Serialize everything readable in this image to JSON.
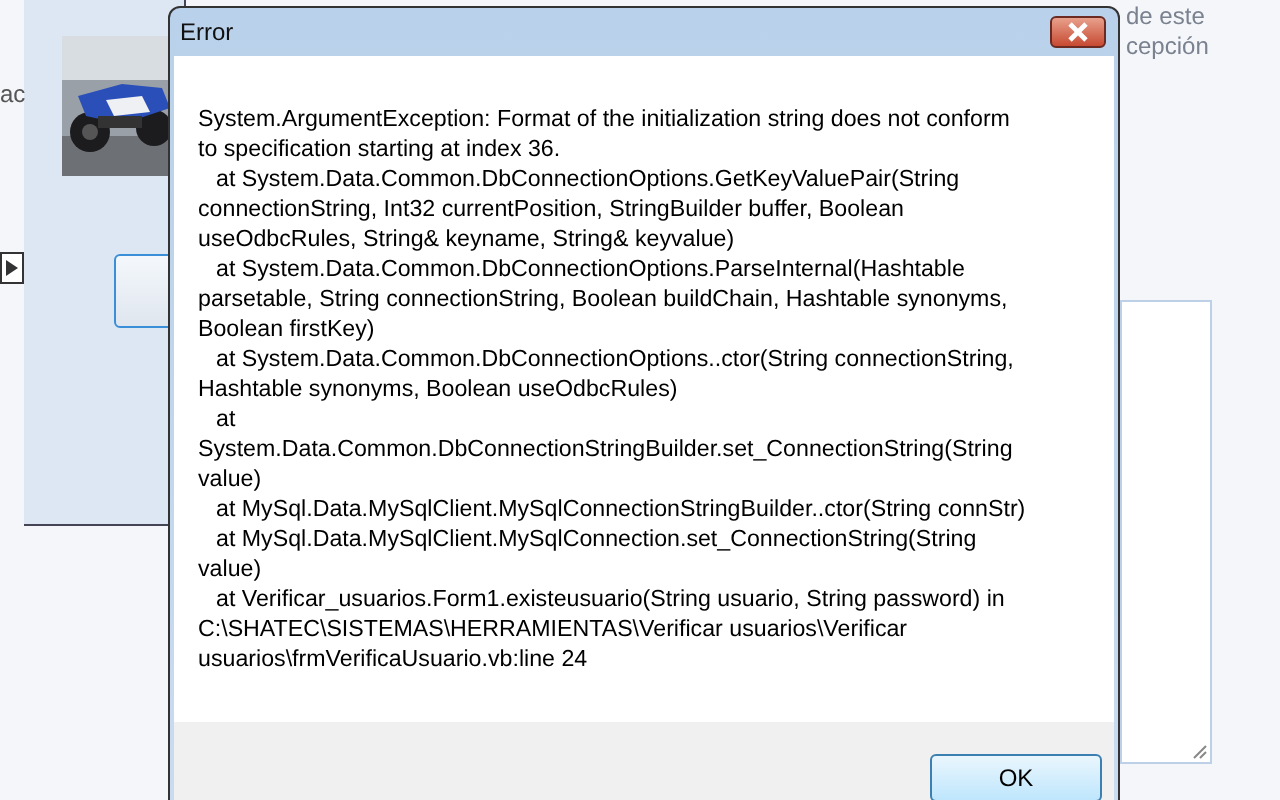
{
  "background_page": {
    "side_text": "ac",
    "right_texts": [
      "de este",
      "cepción"
    ]
  },
  "dialog": {
    "title": "Error",
    "message_lines": [
      {
        "text": "System.ArgumentException: Format of the initialization string does not conform",
        "indented": false
      },
      {
        "text": "to specification starting at index 36.",
        "indented": false
      },
      {
        "text": "at System.Data.Common.DbConnectionOptions.GetKeyValuePair(String",
        "indented": true
      },
      {
        "text": "connectionString, Int32 currentPosition, StringBuilder buffer, Boolean",
        "indented": false
      },
      {
        "text": "useOdbcRules, String& keyname, String& keyvalue)",
        "indented": false
      },
      {
        "text": "at System.Data.Common.DbConnectionOptions.ParseInternal(Hashtable",
        "indented": true
      },
      {
        "text": "parsetable, String connectionString, Boolean buildChain, Hashtable synonyms,",
        "indented": false
      },
      {
        "text": "Boolean firstKey)",
        "indented": false
      },
      {
        "text": "at System.Data.Common.DbConnectionOptions..ctor(String connectionString,",
        "indented": true
      },
      {
        "text": "Hashtable synonyms, Boolean useOdbcRules)",
        "indented": false
      },
      {
        "text": "at",
        "indented": true
      },
      {
        "text": "System.Data.Common.DbConnectionStringBuilder.set_ConnectionString(String",
        "indented": false
      },
      {
        "text": "value)",
        "indented": false
      },
      {
        "text": "at MySql.Data.MySqlClient.MySqlConnectionStringBuilder..ctor(String connStr)",
        "indented": true
      },
      {
        "text": "at MySql.Data.MySqlClient.MySqlConnection.set_ConnectionString(String",
        "indented": true
      },
      {
        "text": "value)",
        "indented": false
      },
      {
        "text": "at Verificar_usuarios.Form1.existeusuario(String usuario, String password) in",
        "indented": true
      },
      {
        "text": "C:\\SHATEC\\SISTEMAS\\HERRAMIENTAS\\Verificar usuarios\\Verificar",
        "indented": false
      },
      {
        "text": "usuarios\\frmVerificaUsuario.vb:line 24",
        "indented": false
      }
    ],
    "buttons": [
      "OK"
    ]
  }
}
